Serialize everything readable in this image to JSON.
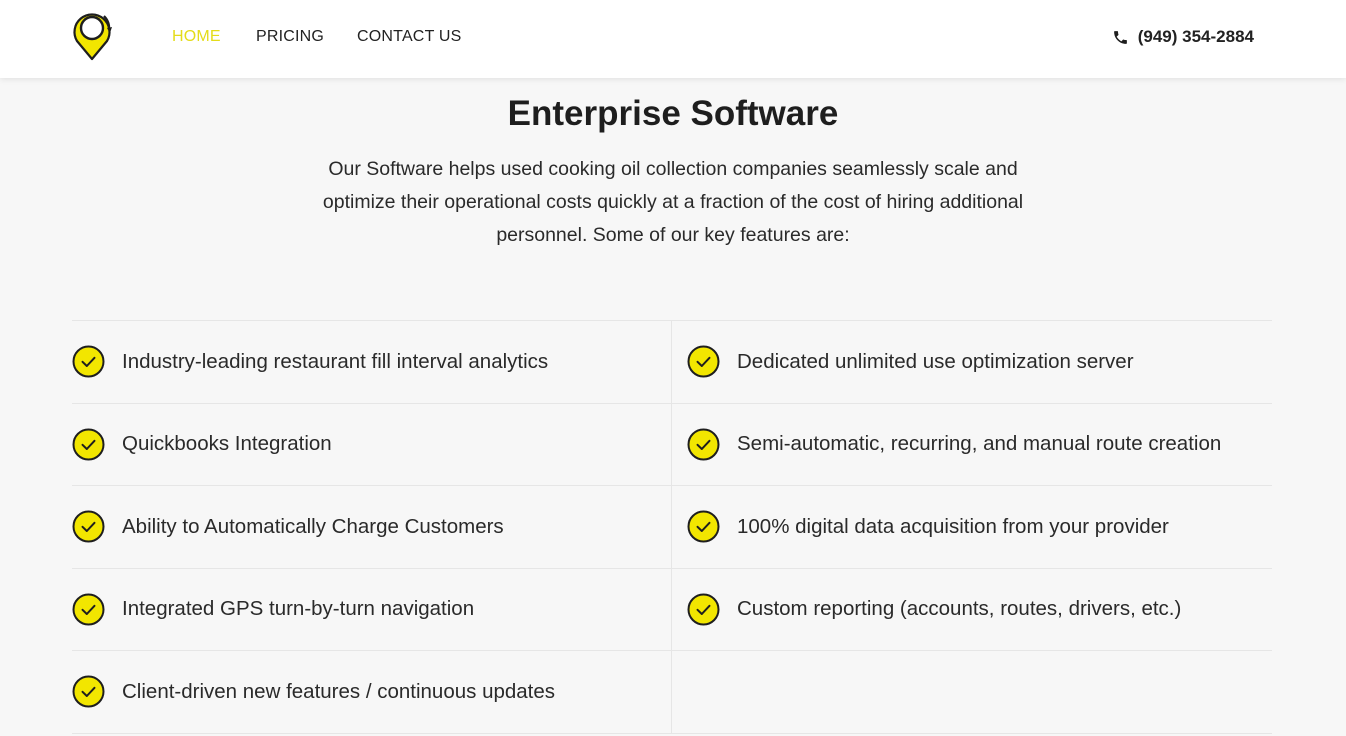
{
  "nav": {
    "logo_icon": "location-pin-logo-icon",
    "links": [
      {
        "label": "HOME",
        "active": true
      },
      {
        "label": "PRICING",
        "active": false
      },
      {
        "label": "CONTACT US",
        "active": false
      }
    ],
    "phone_icon": "phone-icon",
    "phone": "(949) 354-2884"
  },
  "hero": {
    "title": "Enterprise Software",
    "intro": "Our Software helps used cooking oil collection companies seamlessly scale and optimize their operational costs quickly at a fraction of the cost of hiring additional personnel. Some of our key features are:"
  },
  "features": {
    "check_icon": "check-circle-icon",
    "items": [
      "Industry-leading restaurant fill interval analytics",
      "Dedicated unlimited use optimization server",
      "Quickbooks Integration",
      "Semi-automatic, recurring, and manual route creation",
      "Ability to Automatically Charge Customers",
      "100% digital data acquisition from your provider",
      "Integrated GPS turn-by-turn navigation",
      "Custom reporting (accounts, routes, drivers, etc.)",
      "Client-driven new features / continuous updates"
    ]
  },
  "colors": {
    "accent": "#e4dc1a",
    "check_fill": "#f2e600",
    "text": "#222222",
    "background": "#f7f7f7"
  }
}
